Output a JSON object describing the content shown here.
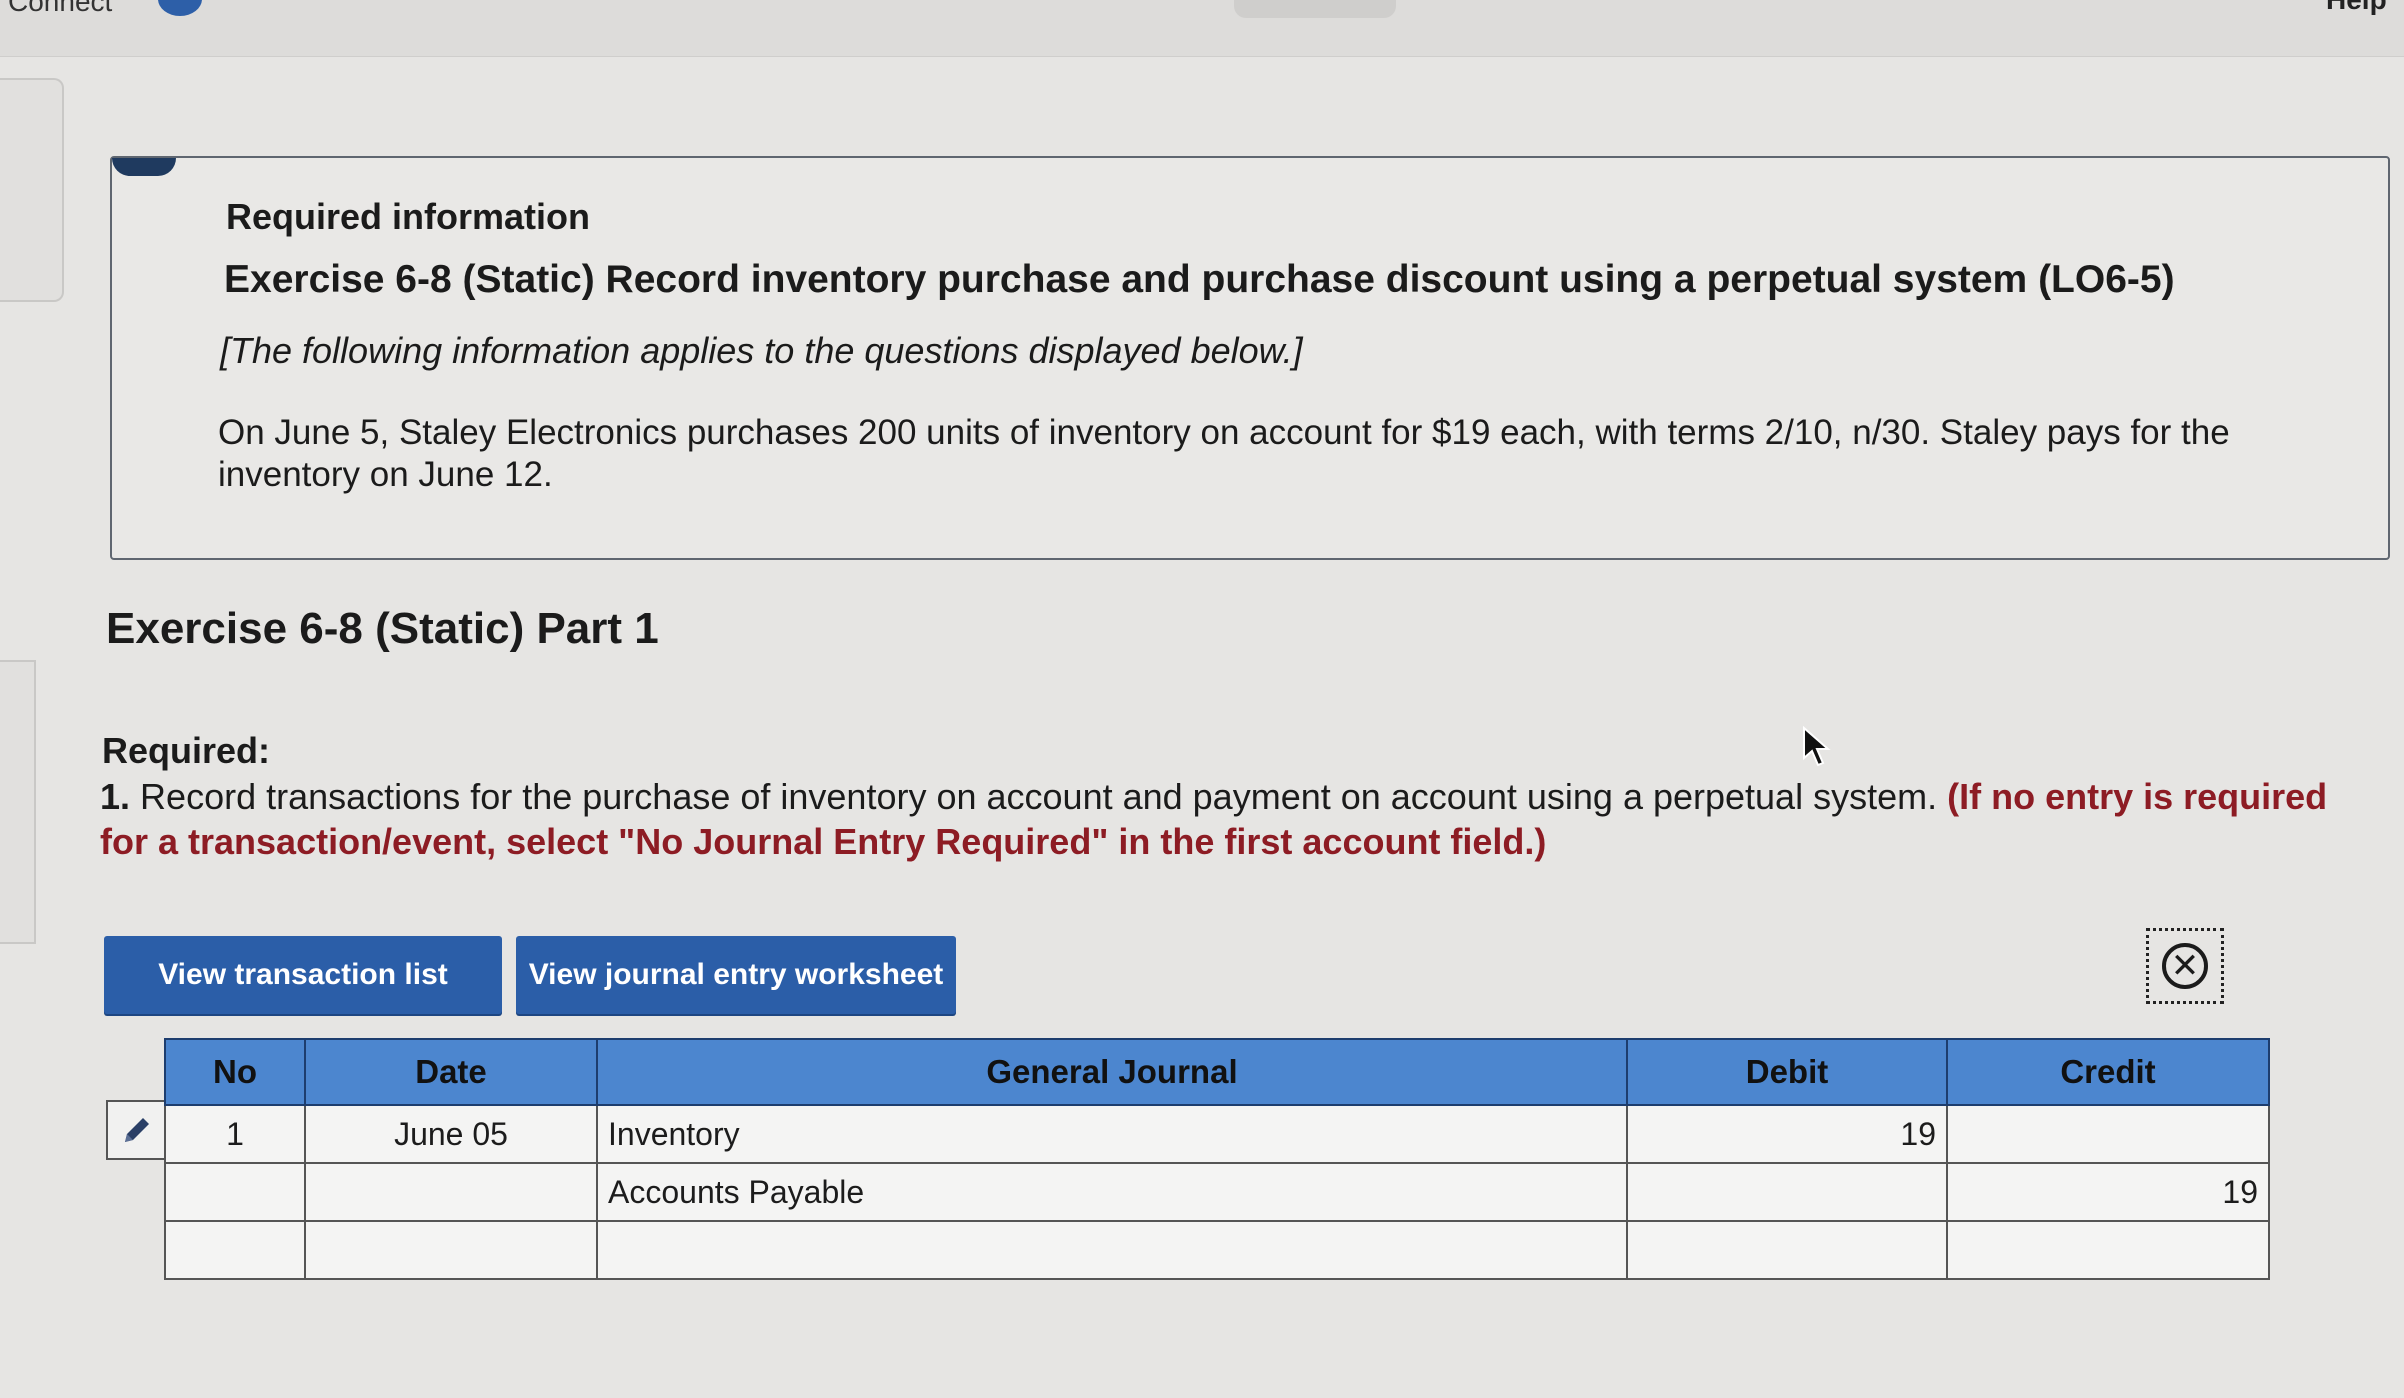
{
  "topbar": {
    "left_text": "Connect",
    "right_text": "Help"
  },
  "info": {
    "label": "Required information",
    "title": "Exercise 6-8 (Static) Record inventory purchase and purchase discount using a perpetual system (LO6-5)",
    "note": "[The following information applies to the questions displayed below.]",
    "paragraph": "On June 5, Staley Electronics purchases 200 units of inventory on account for $19 each, with terms 2/10, n/30. Staley pays for the inventory on June 12."
  },
  "part": {
    "title": "Exercise 6-8 (Static) Part 1",
    "required_label": "Required:",
    "item_number": "1.",
    "item_text": "Record transactions for the purchase of inventory on account and payment on account using a perpetual system.",
    "item_instruction": "(If no entry is required for a transaction/event, select \"No Journal Entry Required\" in the first account field.)"
  },
  "buttons": {
    "transaction_list": "View transaction list",
    "journal_worksheet": "View journal entry worksheet"
  },
  "icons": {
    "close": "close-circle-icon",
    "edit": "pencil-icon",
    "cursor": "mouse-pointer-icon"
  },
  "journal": {
    "headers": {
      "no": "No",
      "date": "Date",
      "general": "General Journal",
      "debit": "Debit",
      "credit": "Credit"
    },
    "rows": [
      {
        "no": "1",
        "date": "June 05",
        "account": "Inventory",
        "debit": "19",
        "credit": ""
      },
      {
        "no": "",
        "date": "",
        "account": "Accounts Payable",
        "debit": "",
        "credit": "19"
      },
      {
        "no": "",
        "date": "",
        "account": "",
        "debit": "",
        "credit": ""
      }
    ]
  },
  "colors": {
    "accent": "#2b5ea8",
    "header": "#4c86cf",
    "instruction": "#8d1c24"
  }
}
